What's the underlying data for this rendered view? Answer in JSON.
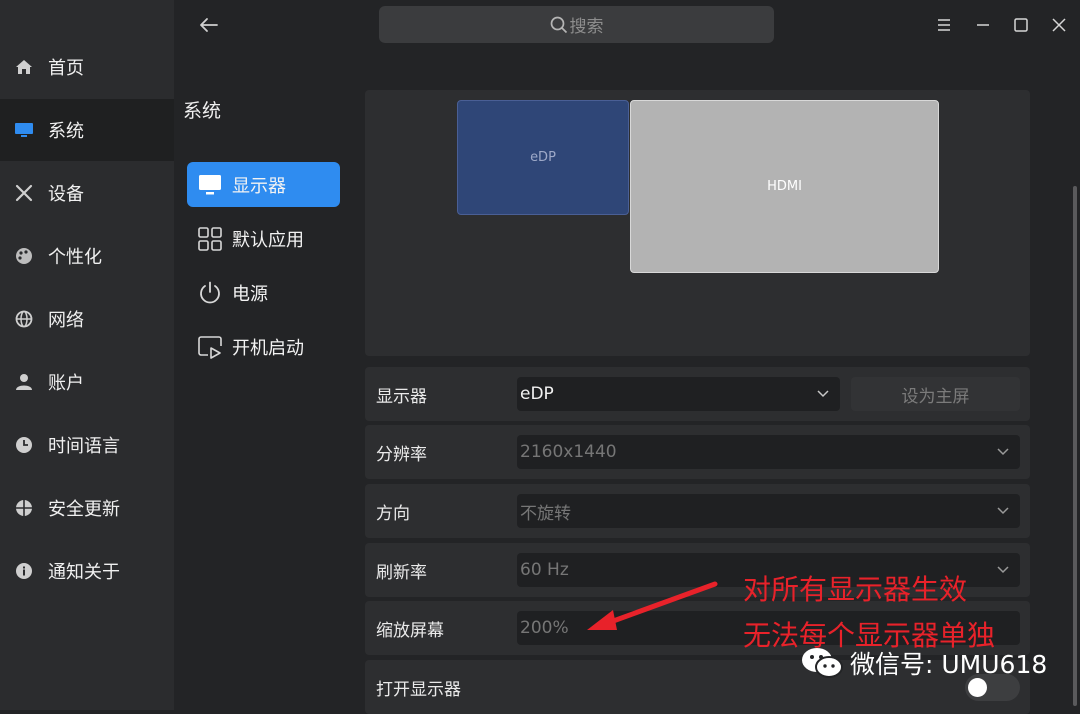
{
  "nav": {
    "items": [
      {
        "label": "首页",
        "icon": "home-icon"
      },
      {
        "label": "系统",
        "icon": "monitor-icon"
      },
      {
        "label": "设备",
        "icon": "tools-icon"
      },
      {
        "label": "个性化",
        "icon": "palette-icon"
      },
      {
        "label": "网络",
        "icon": "globe-icon"
      },
      {
        "label": "账户",
        "icon": "user-icon"
      },
      {
        "label": "时间语言",
        "icon": "clock-icon"
      },
      {
        "label": "安全更新",
        "icon": "shield-icon"
      },
      {
        "label": "通知关于",
        "icon": "info-icon"
      }
    ],
    "active_index": 1,
    "accent": "#2f8cf0"
  },
  "search": {
    "placeholder": "搜索"
  },
  "section": {
    "title": "系统",
    "items": [
      {
        "label": "显示器",
        "icon": "display-icon"
      },
      {
        "label": "默认应用",
        "icon": "apps-grid-icon"
      },
      {
        "label": "电源",
        "icon": "power-icon"
      },
      {
        "label": "开机启动",
        "icon": "autostart-icon"
      }
    ],
    "active_index": 0
  },
  "preview": {
    "monitors": [
      {
        "label": "eDP",
        "color": "#2f4677"
      },
      {
        "label": "HDMI",
        "color": "#b3b3b3"
      }
    ]
  },
  "settings": {
    "display": {
      "label": "显示器",
      "value": "eDP",
      "primary_button": "设为主屏"
    },
    "resolution": {
      "label": "分辨率",
      "value": "2160x1440"
    },
    "orientation": {
      "label": "方向",
      "value": "不旋转"
    },
    "refresh": {
      "label": "刷新率",
      "value": "60 Hz"
    },
    "scale": {
      "label": "缩放屏幕",
      "value": "200%"
    },
    "enable": {
      "label": "打开显示器",
      "on": false
    }
  },
  "annotation": {
    "line1": "对所有显示器生效",
    "line2": "无法每个显示器单独",
    "color": "#e8222a"
  },
  "watermark": {
    "text": "微信号: UMU618"
  }
}
